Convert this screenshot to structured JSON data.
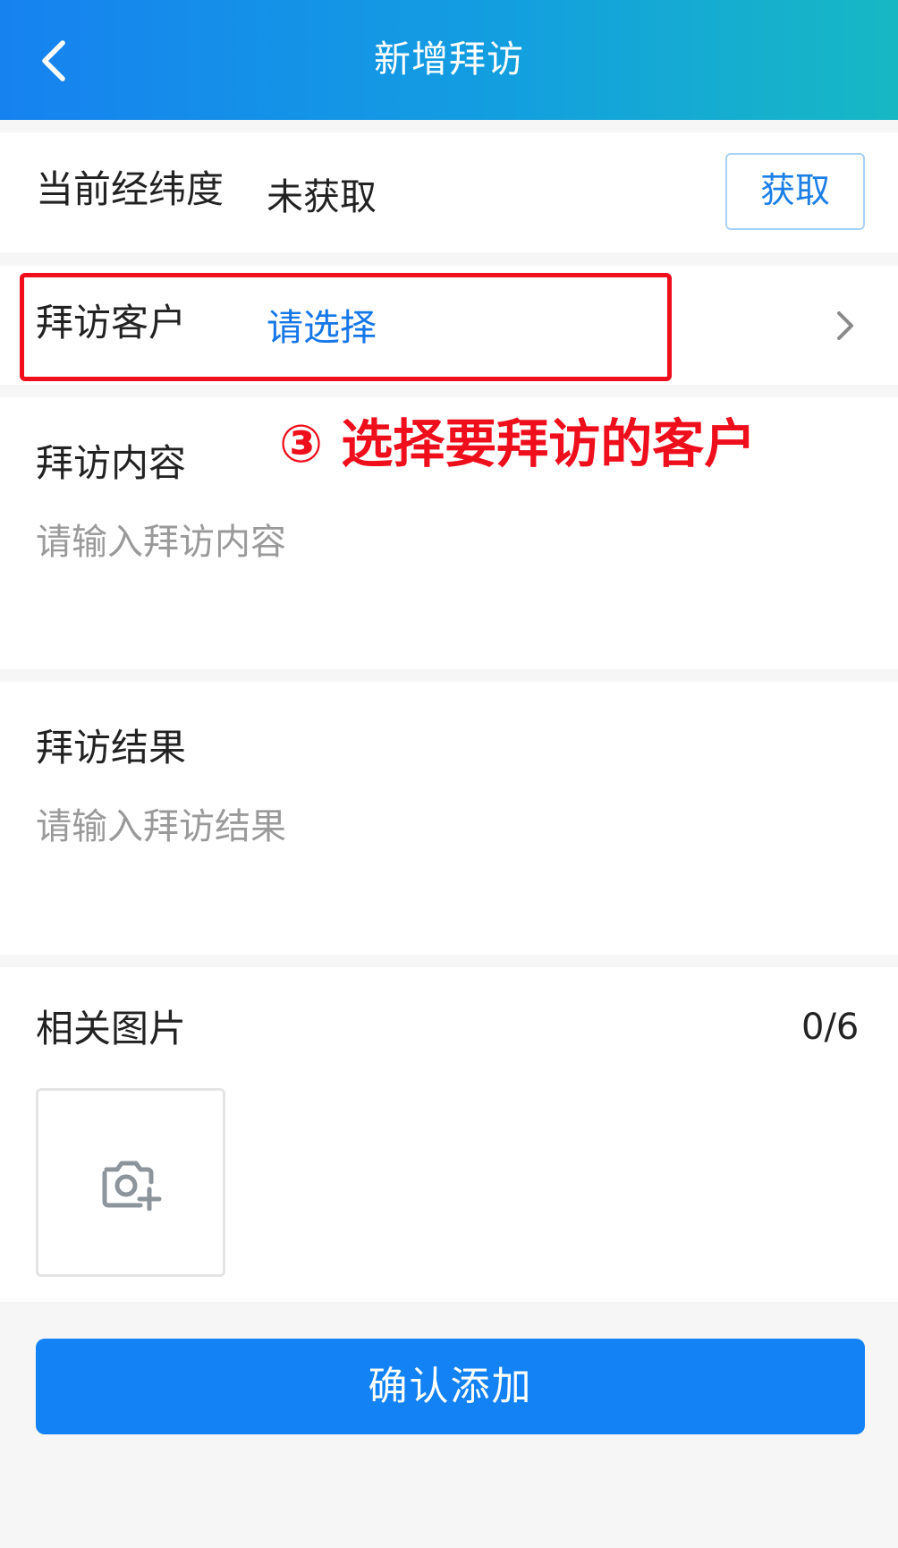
{
  "header": {
    "title": "新增拜访",
    "back_icon": "chevron-left-icon"
  },
  "location": {
    "label": "当前经纬度",
    "value": "未获取",
    "get_button": "获取"
  },
  "customer": {
    "label": "拜访客户",
    "value": "请选择",
    "chevron_icon": "chevron-right-icon"
  },
  "annotation": {
    "text": "③ 选择要拜访的客户",
    "color": "#ef0e1c"
  },
  "content": {
    "label": "拜访内容",
    "placeholder": "请输入拜访内容"
  },
  "result": {
    "label": "拜访结果",
    "placeholder": "请输入拜访结果"
  },
  "images": {
    "label": "相关图片",
    "count": "0/6",
    "upload_icon": "camera-plus-icon"
  },
  "confirm_button": "确认添加",
  "colors": {
    "primary": "#1282f5",
    "link": "#1677e8",
    "annotation": "#ef0e1c",
    "placeholder": "#9a9a9a"
  }
}
